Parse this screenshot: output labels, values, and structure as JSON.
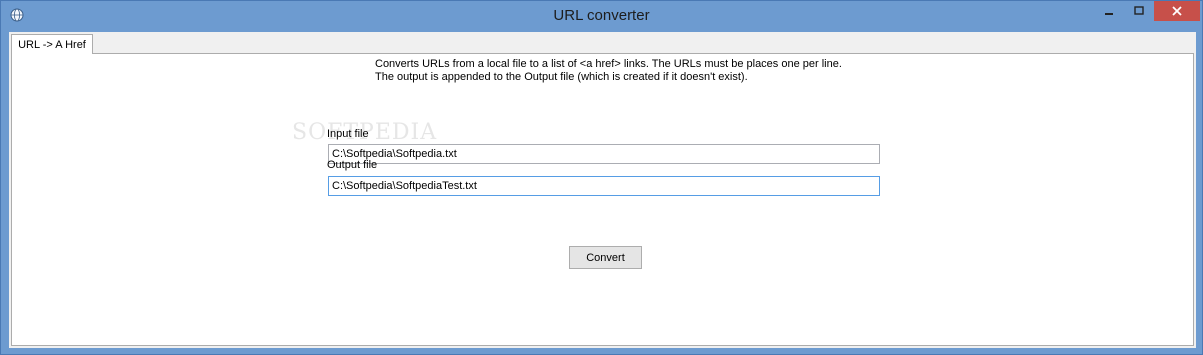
{
  "window": {
    "title": "URL converter",
    "icon": "globe-icon",
    "controls": {
      "minimize": "minimize-icon",
      "maximize": "maximize-icon",
      "close": "close-icon"
    }
  },
  "tabs": [
    {
      "label": "URL -> A Href",
      "active": true
    }
  ],
  "main": {
    "description_line1": "Converts URLs from a local file to a list of <a href> links. The URLs must be places one per line.",
    "description_line2": "The output is appended to the Output file (which is created if it doesn't exist).",
    "input_label": "Input file",
    "input_value": "C:\\Softpedia\\Softpedia.txt",
    "output_label": "Output file",
    "output_value": "C:\\Softpedia\\SoftpediaTest.txt",
    "convert_label": "Convert",
    "watermark": "SOFTPEDIA"
  },
  "colors": {
    "frame": "#6d9bd0",
    "close_button": "#c7504a",
    "focus_border": "#569de5"
  }
}
